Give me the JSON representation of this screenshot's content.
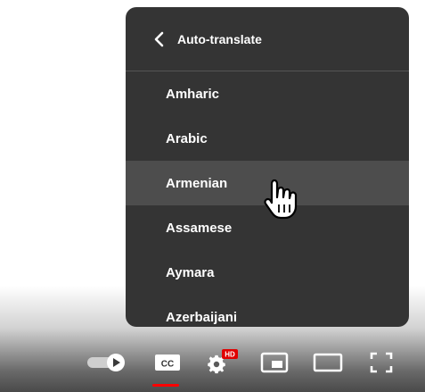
{
  "menu": {
    "title": "Auto-translate",
    "items": [
      {
        "label": "Amharic"
      },
      {
        "label": "Arabic"
      },
      {
        "label": "Armenian"
      },
      {
        "label": "Assamese"
      },
      {
        "label": "Aymara"
      },
      {
        "label": "Azerbaijani"
      }
    ],
    "hovered_item": "Armenian"
  },
  "controls": {
    "settings_badge": "HD",
    "cc_label": "CC"
  },
  "colors": {
    "menu_bg": "#343434",
    "hover_bg": "#4d4d4d",
    "accent_red": "#ff0000"
  }
}
